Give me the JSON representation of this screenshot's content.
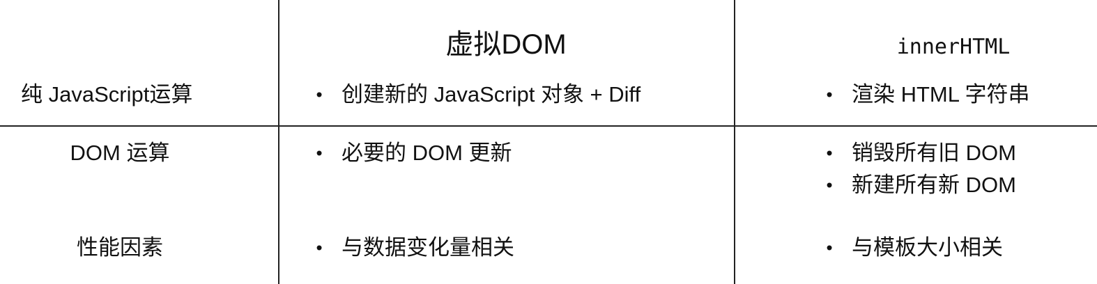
{
  "headers": {
    "virtual_dom": "虚拟DOM",
    "inner_html": "innerHTML"
  },
  "rows": [
    {
      "label": "纯 JavaScript运算",
      "virtual_dom": [
        "创建新的 JavaScript 对象 +  Diff"
      ],
      "inner_html": [
        "渲染 HTML 字符串"
      ]
    },
    {
      "label": "DOM 运算",
      "virtual_dom": [
        "必要的 DOM 更新"
      ],
      "inner_html": [
        "销毁所有旧 DOM",
        "新建所有新 DOM"
      ]
    },
    {
      "label": "性能因素",
      "virtual_dom": [
        "与数据变化量相关"
      ],
      "inner_html": [
        "与模板大小相关"
      ]
    }
  ]
}
